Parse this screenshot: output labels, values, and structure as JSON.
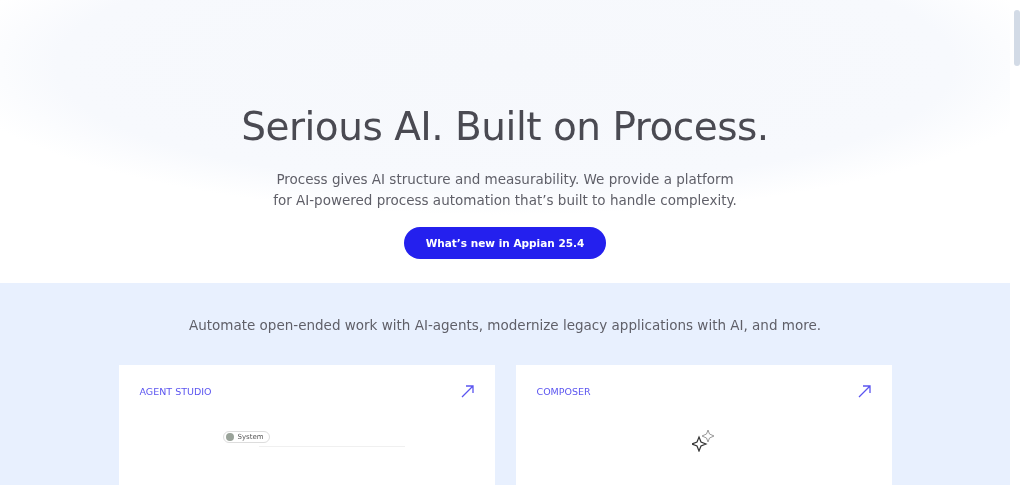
{
  "hero": {
    "title": "Serious AI. Built on Process.",
    "lines": [
      "Process gives AI structure and measurability. We provide a platform",
      "for AI-powered process automation that’s built to handle complexity."
    ],
    "button": "What’s new in Appian 25.4"
  },
  "products": {
    "intro": "Automate open-ended work with AI-agents, modernize legacy applications with AI, and more.",
    "cards": [
      {
        "kind": "agent",
        "label": "AGENT STUDIO",
        "chip": "System"
      },
      {
        "kind": "composer",
        "label": "COMPOSER"
      }
    ]
  }
}
